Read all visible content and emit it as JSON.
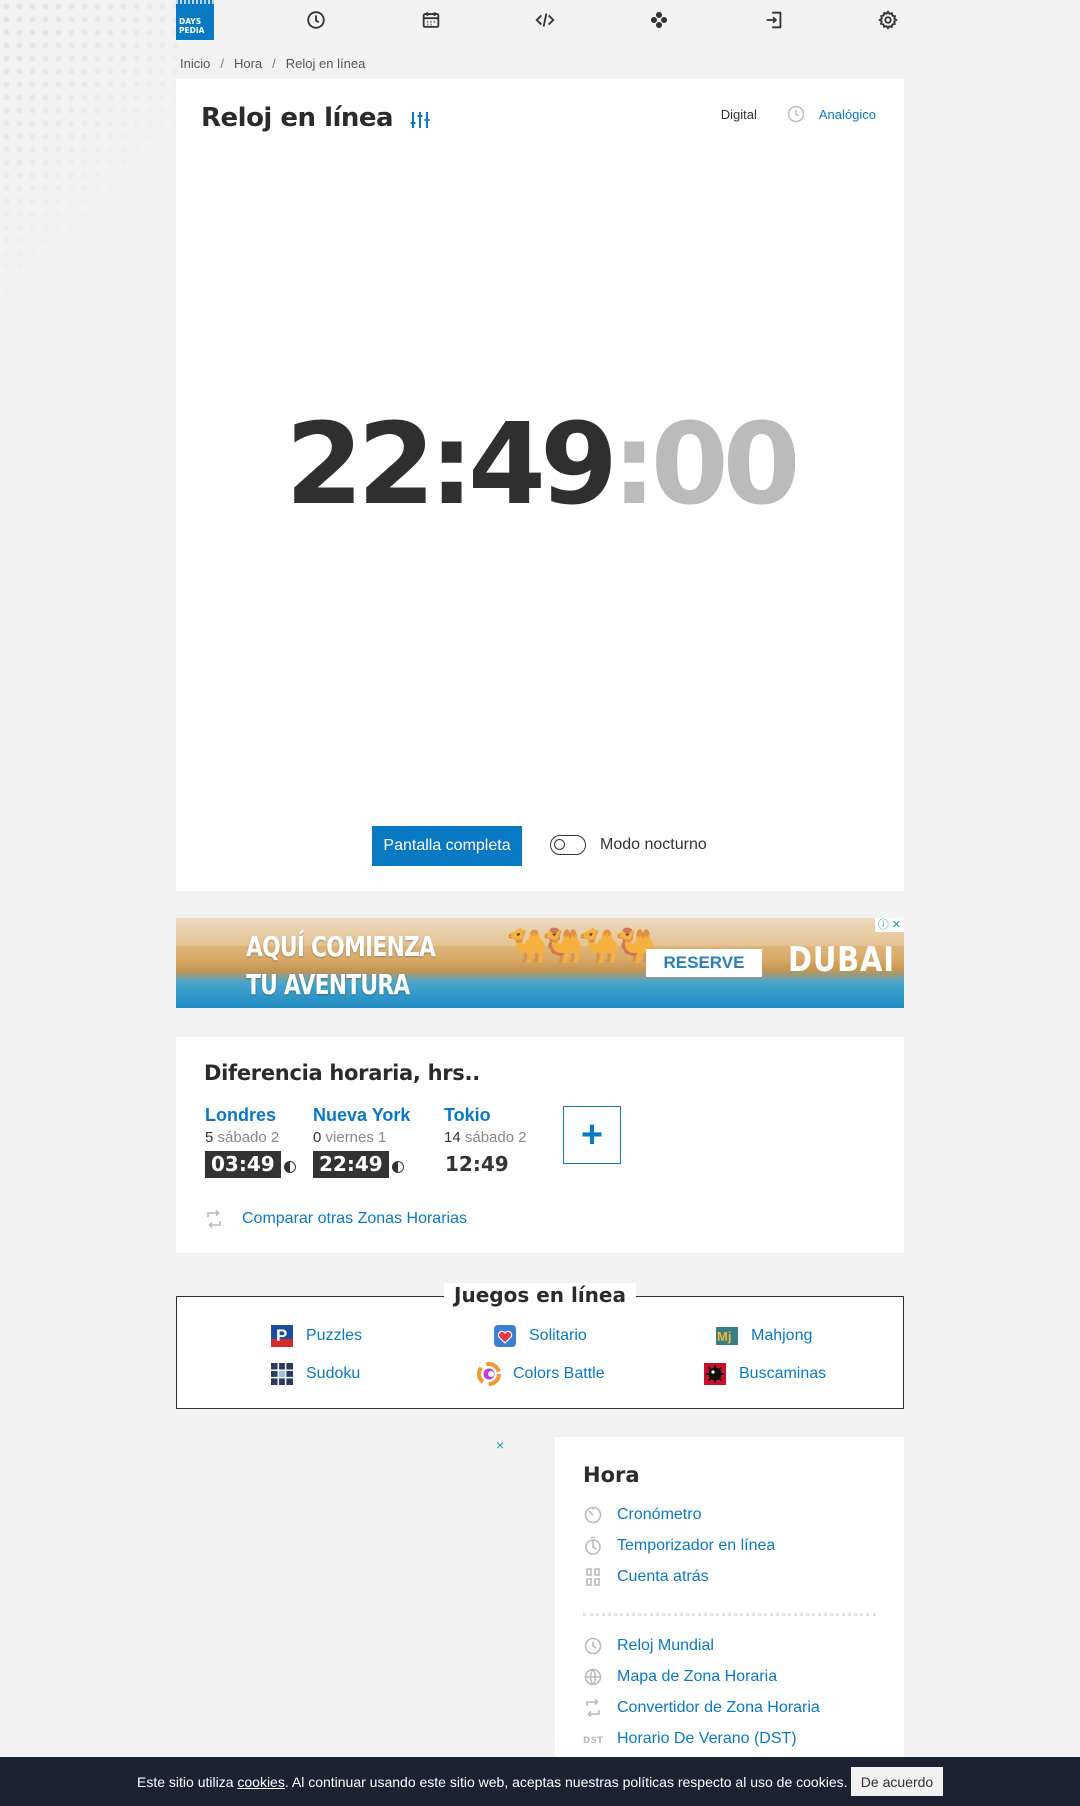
{
  "logo": {
    "line1": "DAYS",
    "line2": "PEDIA"
  },
  "nav": {
    "icons": [
      "clock-icon",
      "calendar-icon",
      "code-icon",
      "games-icon",
      "login-icon",
      "settings-icon"
    ]
  },
  "breadcrumb": {
    "items": [
      "Inicio",
      "Hora",
      "Reloj en línea"
    ],
    "separator": "/"
  },
  "clock_card": {
    "title": "Reloj en línea",
    "mode_digital": "Digital",
    "mode_analog": "Analógico",
    "time_hm": "22:49",
    "time_sep": ":",
    "time_sec": "00",
    "fullscreen_label": "Pantalla completa",
    "night_mode_label": "Modo nocturno"
  },
  "ad_banner": {
    "line1": "AQUÍ COMIENZA",
    "line2": "TU AVENTURA",
    "button": "RESERVE",
    "brand": "DUBAI"
  },
  "time_difference": {
    "title": "Diferencia horaria, hrs..",
    "cities": [
      {
        "name": "Londres",
        "offset": "5",
        "day": "sábado 2",
        "time": "03:49",
        "highlight": true
      },
      {
        "name": "Nueva York",
        "offset": "0",
        "day": "viernes 1",
        "time": "22:49",
        "highlight": true
      },
      {
        "name": "Tokio",
        "offset": "14",
        "day": "sábado 2",
        "time": "12:49",
        "highlight": false
      }
    ],
    "add_label": "+",
    "compare_link": "Comparar otras Zonas Horarias"
  },
  "games": {
    "title": "Juegos en línea",
    "items": [
      {
        "label": "Puzzles",
        "icon": "puzzles-icon"
      },
      {
        "label": "Solitario",
        "icon": "solitaire-icon"
      },
      {
        "label": "Mahjong",
        "icon": "mahjong-icon"
      },
      {
        "label": "Sudoku",
        "icon": "sudoku-icon"
      },
      {
        "label": "Colors Battle",
        "icon": "colors-battle-icon"
      },
      {
        "label": "Buscaminas",
        "icon": "minesweeper-icon"
      }
    ]
  },
  "ad_close": "×",
  "sidebar": {
    "title": "Hora",
    "group1": [
      {
        "label": "Cronómetro",
        "icon": "stopwatch-icon"
      },
      {
        "label": "Temporizador en línea",
        "icon": "timer-icon"
      },
      {
        "label": "Cuenta atrás",
        "icon": "countdown-icon"
      }
    ],
    "group2": [
      {
        "label": "Reloj Mundial",
        "icon": "world-clock-icon"
      },
      {
        "label": "Mapa de Zona Horaria",
        "icon": "globe-icon"
      },
      {
        "label": "Convertidor de Zona Horaria",
        "icon": "convert-icon"
      },
      {
        "label": "Horario De Verano (DST)",
        "icon": "dst-icon"
      }
    ]
  },
  "cookie_bar": {
    "text_before": "Este sitio utiliza ",
    "link": "cookies",
    "text_after": ". Al continuar usando este sitio web, aceptas nuestras políticas respecto al uso de cookies.",
    "button": "De acuerdo"
  },
  "colors": {
    "accent": "#0a79c4",
    "dark": "#333333",
    "cookie_bg": "#1d2233"
  }
}
